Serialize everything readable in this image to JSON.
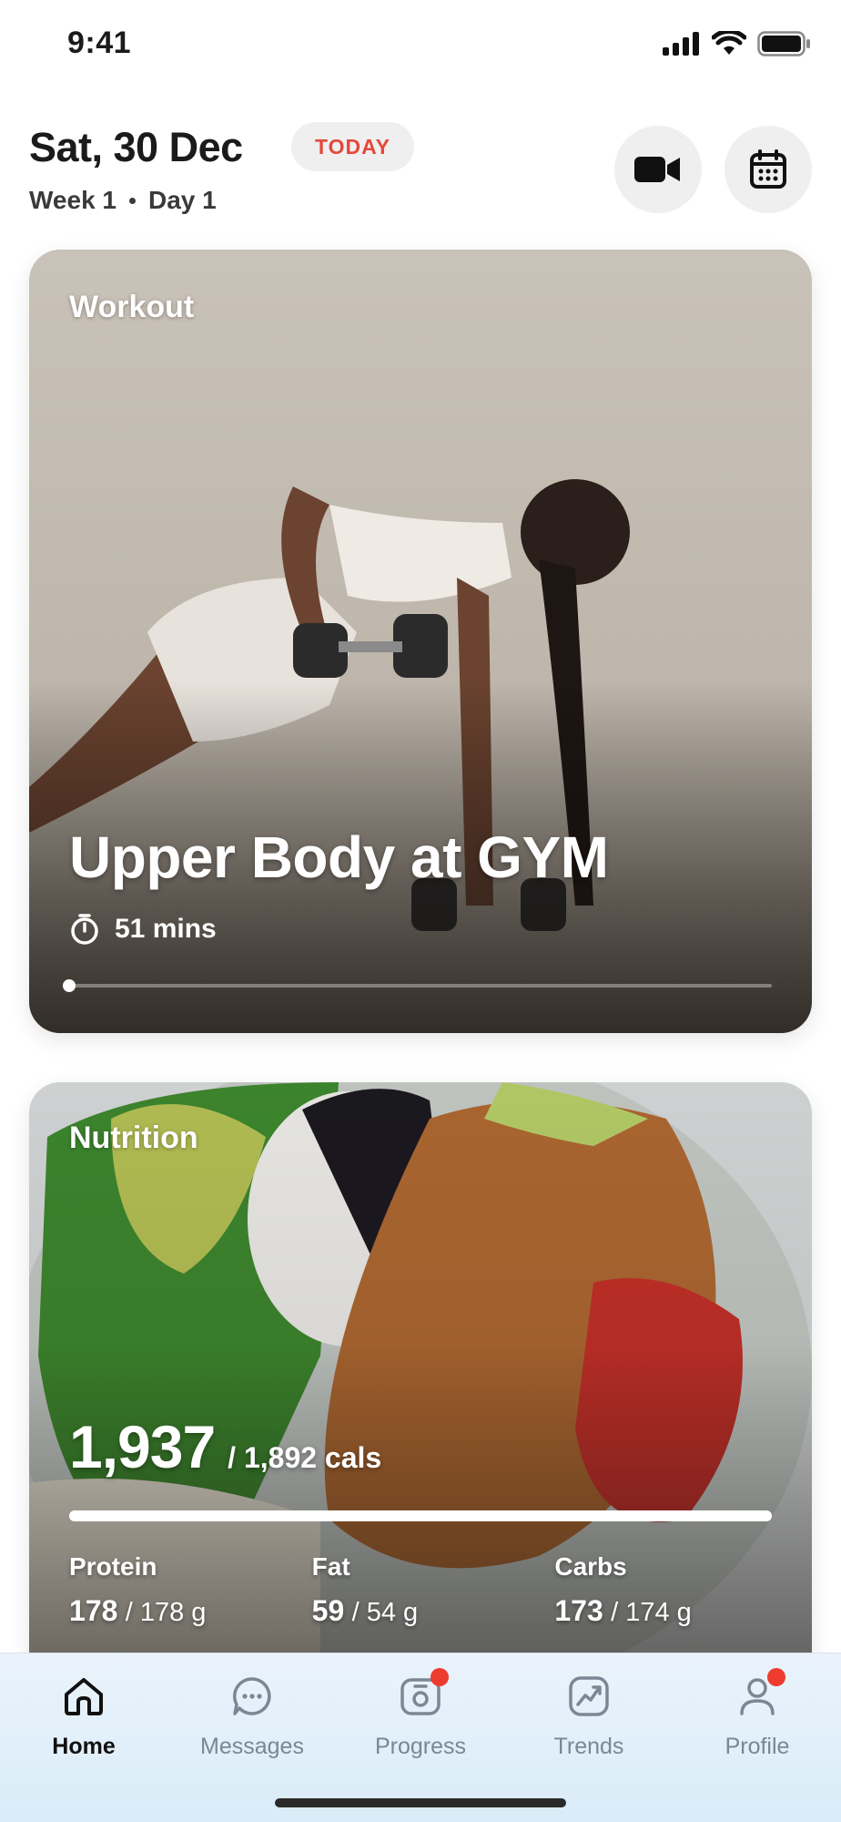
{
  "status_bar": {
    "time": "9:41"
  },
  "header": {
    "date": "Sat, 30 Dec",
    "today_badge": "TODAY",
    "week": "Week 1",
    "day": "Day 1"
  },
  "workout": {
    "label": "Workout",
    "title": "Upper Body at GYM",
    "duration": "51 mins",
    "progress_fraction": 0.0
  },
  "nutrition": {
    "label": "Nutrition",
    "calories": "1,937",
    "calories_target": "/ 1,892 cals",
    "calorie_progress_fraction": 1.0,
    "macros": [
      {
        "name": "Protein",
        "value": "178",
        "target": "/ 178 g"
      },
      {
        "name": "Fat",
        "value": "59",
        "target": "/ 54 g"
      },
      {
        "name": "Carbs",
        "value": "173",
        "target": "/ 174 g"
      }
    ]
  },
  "nav": {
    "items": [
      {
        "label": "Home",
        "icon": "home-icon",
        "active": true,
        "badge": false
      },
      {
        "label": "Messages",
        "icon": "messages-icon",
        "active": false,
        "badge": false
      },
      {
        "label": "Progress",
        "icon": "progress-camera-icon",
        "active": false,
        "badge": true
      },
      {
        "label": "Trends",
        "icon": "trends-icon",
        "active": false,
        "badge": false
      },
      {
        "label": "Profile",
        "icon": "profile-icon",
        "active": false,
        "badge": true
      }
    ]
  },
  "colors": {
    "accent_red": "#e5483b",
    "badge_red": "#ee3b2f",
    "nav_bg": "#e3f0fa"
  }
}
